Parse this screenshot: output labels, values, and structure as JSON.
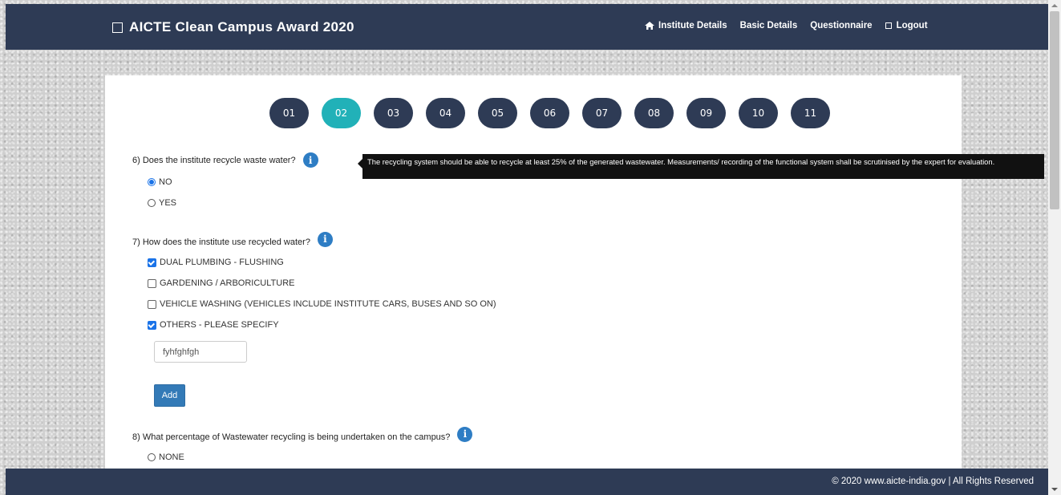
{
  "navbar": {
    "brand": "AICTE Clean Campus Award 2020",
    "links": [
      {
        "label": "Institute Details",
        "icon": "home-icon"
      },
      {
        "label": "Basic Details"
      },
      {
        "label": "Questionnaire"
      },
      {
        "label": "Logout",
        "icon": "box-icon"
      }
    ]
  },
  "steps": [
    "01",
    "02",
    "03",
    "04",
    "05",
    "06",
    "07",
    "08",
    "09",
    "10",
    "11"
  ],
  "active_step": "02",
  "q6": {
    "question": "6) Does the institute recycle waste water?",
    "tooltip": "The recycling system should be able to recycle at least 25% of the generated wastewater. Measurements/ recording of the functional system shall be scrutinised by the expert for evaluation.",
    "options": [
      {
        "label": "NO",
        "selected": true
      },
      {
        "label": "YES",
        "selected": false
      }
    ]
  },
  "q7": {
    "question": "7) How does the institute use recycled water?",
    "options": [
      {
        "label": "DUAL PLUMBING - FLUSHING",
        "checked": true
      },
      {
        "label": "GARDENING / ARBORICULTURE",
        "checked": false
      },
      {
        "label": "VEHICLE WASHING (VEHICLES INCLUDE INSTITUTE CARS, BUSES AND SO ON)",
        "checked": false
      },
      {
        "label": "OTHERS - PLEASE SPECIFY",
        "checked": true
      }
    ],
    "other_value": "fyhfghfgh",
    "add_label": "Add"
  },
  "q8": {
    "question": "8) What percentage of Wastewater recycling is being undertaken on the campus?",
    "options": [
      {
        "label": "NONE",
        "selected": false
      }
    ]
  },
  "footer": "© 2020 www.aicte-india.gov | All Rights Reserved",
  "colors": {
    "navbar": "#2e3b55",
    "step": "#2e3b55",
    "step_active": "#21b1b8",
    "info": "#2e7dc4",
    "button": "#337ab7"
  }
}
